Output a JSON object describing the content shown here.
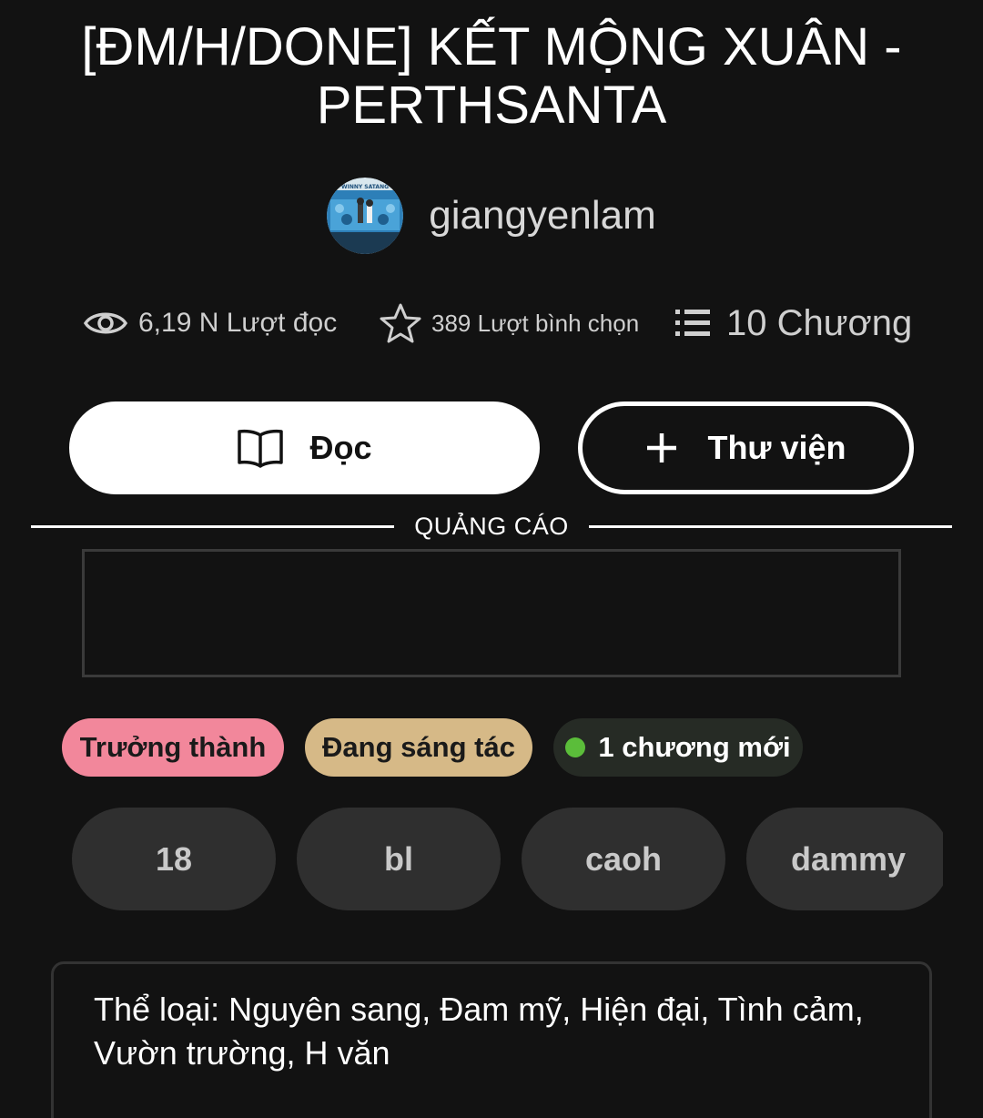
{
  "story": {
    "title": "[ĐM/H/DONE] KẾT MỘNG XUÂN - PERTHSANTA"
  },
  "author": {
    "name": "giangyenlam",
    "avatar_text": "WINNY SATANG"
  },
  "stats": {
    "reads": "6,19 N Lượt đọc",
    "votes": "389 Lượt bình chọn",
    "parts": "10 Chương",
    "reads_icon": "eye-icon",
    "votes_icon": "star-icon",
    "parts_icon": "list-icon"
  },
  "actions": {
    "read_label": "Đọc",
    "library_label": "Thư viện",
    "read_icon": "book-icon",
    "library_icon": "plus-icon"
  },
  "ad": {
    "label": "QUẢNG CÁO"
  },
  "badges": [
    {
      "label": "Trưởng thành",
      "color": "#f2879b"
    },
    {
      "label": "Đang sáng tác",
      "color": "#d6b987"
    },
    {
      "label": "1 chương mới",
      "color": "#262b25",
      "dot_color": "#5bbd3a"
    }
  ],
  "tags": [
    "18",
    "bl",
    "caoh",
    "dammy"
  ],
  "description": {
    "text": "Thể loại: Nguyên sang, Đam mỹ, Hiện đại, Tình cảm, Vườn trường, H văn"
  },
  "colors": {
    "background": "#121212",
    "tag_background": "#2f2f2f"
  }
}
